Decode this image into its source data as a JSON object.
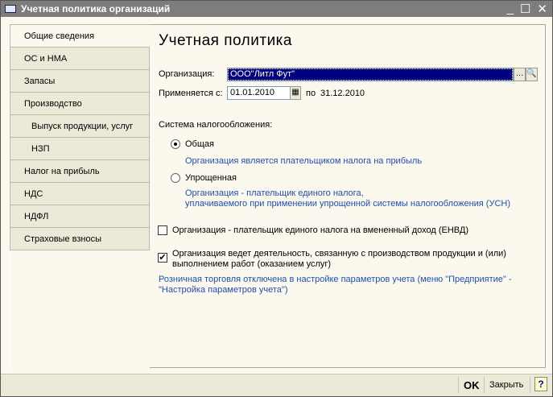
{
  "window": {
    "title": "Учетная политика организаций"
  },
  "tabs": [
    "Общие сведения",
    "ОС и НМА",
    "Запасы",
    "Производство",
    "Выпуск продукции, услуг",
    "НЗП",
    "Налог на прибыль",
    "НДС",
    "НДФЛ",
    "Страховые взносы"
  ],
  "main": {
    "heading": "Учетная политика",
    "org_label": "Организация:",
    "org_value": "ООО\"Литл Фут\"",
    "applies_label": "Применяется с:",
    "date_from": "01.01.2010",
    "to_label": "по",
    "date_to": "31.12.2010",
    "tax_system_label": "Система налогообложения:",
    "radio_general": "Общая",
    "radio_general_note": "Организация является плательщиком налога на прибыль",
    "radio_simple": "Упрощенная",
    "radio_simple_note1": "Организация - плательщик единого налога,",
    "radio_simple_note2": "уплачиваемого при применении упрощенной системы налогообложения (УСН)",
    "envd_label": "Организация - плательщик единого налога на вмененный доход (ЕНВД)",
    "production_label1": "Организация ведет деятельность, связанную с производством  продукции и (или)",
    "production_label2": "выполнением работ (оказанием услуг)",
    "retail_note1": "Розничная торговля отключена в настройке параметров учета (меню \"Предприятие\" -",
    "retail_note2": "\"Настройка параметров учета\")"
  },
  "footer": {
    "ok": "OK",
    "close": "Закрыть",
    "help": "?"
  }
}
